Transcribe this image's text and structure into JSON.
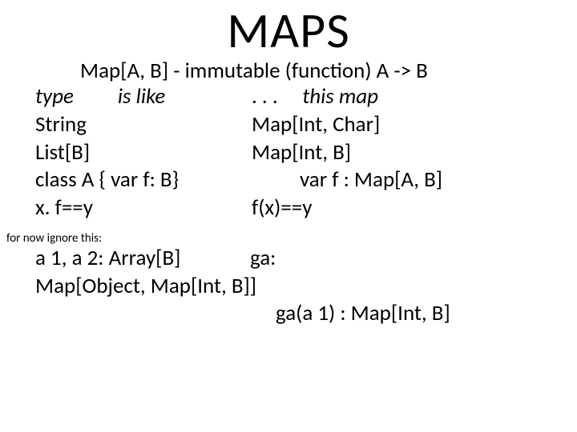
{
  "title": "MAPS",
  "subtitle": "Map[A, B] - immutable (function) A -> B",
  "rows": [
    {
      "left_a": "type",
      "left_b": "is like",
      "right_a": ". . .",
      "right_b": "this map"
    },
    {
      "left": "String",
      "right": "Map[Int, Char]"
    },
    {
      "left": "List[B]",
      "right": "Map[Int, B]"
    },
    {
      "left": "class A { var f: B}",
      "right": "var f : Map[A, B]"
    },
    {
      "left": "x. f==y",
      "right": "f(x)==y"
    }
  ],
  "footnote": "for now ignore this:",
  "bottom": {
    "line1_left": "a 1, a 2: Array[B]",
    "line1_right": "ga:",
    "line2": "Map[Object, Map[Int, B]]",
    "line3": "ga(a 1) : Map[Int, B]"
  }
}
